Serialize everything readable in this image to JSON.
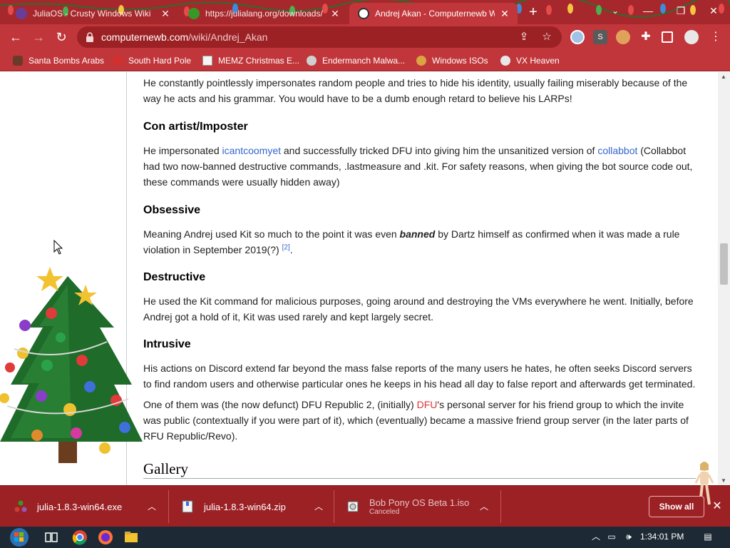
{
  "browser": {
    "tabs": [
      {
        "title": "JuliaOS - Crusty Windows Wiki",
        "active": false
      },
      {
        "title": "https://julialang.org/downloads/",
        "active": false
      },
      {
        "title": "Andrej Akan - Computernewb W",
        "active": true
      }
    ],
    "address": {
      "domain": "computernewb.com",
      "path": "/wiki/Andrej_Akan"
    },
    "bookmarks": [
      "Santa Bombs Arabs",
      "South Hard Pole",
      "MEMZ Christmas E...",
      "Endermanch Malwa...",
      "Windows ISOs",
      "VX Heaven"
    ],
    "extension_badge": "S"
  },
  "article": {
    "intro_p": "He constantly pointlessly impersonates random people and tries to hide his identity, usually failing miserably because of the way he acts and his grammar. You would have to be a dumb enough retard to believe his LARPs!",
    "con_artist": {
      "heading": "Con artist/Imposter",
      "t1": "He impersonated ",
      "link1": "icantcoomyet",
      "t2": " and successfully tricked DFU into giving him the unsanitized version of ",
      "link2": "collabbot",
      "t3": " (Collabbot had two now-banned destructive commands, .lastmeasure and .kit. For safety reasons, when giving the bot source code out, these commands were usually hidden away)"
    },
    "obsessive": {
      "heading": "Obsessive",
      "t1": "Meaning Andrej used Kit so much to the point it was even ",
      "bold": "banned",
      "t2": " by Dartz himself as confirmed when it was made a rule violation in September 2019(?) ",
      "ref": "[2]",
      "t3": "."
    },
    "destructive": {
      "heading": "Destructive",
      "text": "He used the Kit command for malicious purposes, going around and destroying the VMs everywhere he went. Initially, before Andrej got a hold of it, Kit was used rarely and kept largely secret."
    },
    "intrusive": {
      "heading": "Intrusive",
      "p1": "His actions on Discord extend far beyond the mass false reports of the many users he hates, he often seeks Discord servers to find random users and otherwise particular ones he keeps in his head all day to false report and afterwards get terminated.",
      "p2_t1": "One of them was (the now defunct) DFU Republic 2, (initially) ",
      "p2_link": "DFU",
      "p2_t2": "'s personal server for his friend group to which the invite was public (contextually if you were part of it), which (eventually) became a massive friend group server (in the later parts of RFU Republic/Revo)."
    },
    "gallery_heading": "Gallery"
  },
  "downloads": [
    {
      "name": "julia-1.8.3-win64.exe",
      "status": ""
    },
    {
      "name": "julia-1.8.3-win64.zip",
      "status": ""
    },
    {
      "name": "Bob Pony OS Beta 1.iso",
      "status": "Canceled"
    }
  ],
  "downloads_show_all": "Show all",
  "taskbar": {
    "time": "1:34:01 PM"
  },
  "colors": {
    "frame": "#c1363a",
    "tabstrip": "#a6282c",
    "download_bar": "#9c2125",
    "link": "#3366cc",
    "redlink": "#d33"
  }
}
